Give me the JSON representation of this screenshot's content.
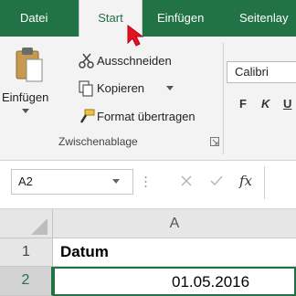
{
  "tabs": [
    "Datei",
    "Start",
    "Einfügen",
    "Seitenlay"
  ],
  "clipboard": {
    "paste_label": "Einfügen",
    "cut_label": "Ausschneiden",
    "copy_label": "Kopieren",
    "format_painter_label": "Format übertragen",
    "group_label": "Zwischenablage"
  },
  "font": {
    "name": "Calibri",
    "bold_label": "F",
    "italic_label": "K",
    "underline_label": "U"
  },
  "formula_bar": {
    "name_box_value": "A2",
    "fx_label": "fx"
  },
  "grid": {
    "column_header": "A",
    "rows": [
      {
        "number": "1",
        "value": "Datum"
      },
      {
        "number": "2",
        "value": "01.05.2016"
      }
    ]
  },
  "colors": {
    "accent": "#217346",
    "ribbon": "#f3f3f3",
    "cursor": "#e81123"
  }
}
